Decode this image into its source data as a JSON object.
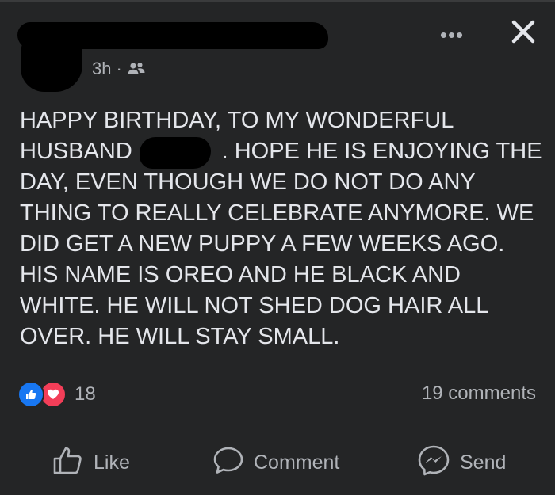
{
  "post": {
    "time": "3h",
    "separator": "·",
    "audience_icon": "friends-icon",
    "text": "HAPPY BIRTHDAY, TO MY WONDERFUL\nHUSBAND              . HOPE HE IS ENJOYING THE\nDAY, EVEN THOUGH WE DO NOT DO ANY\nTHING TO REALLY CELEBRATE ANYMORE. WE\nDID GET A NEW PUPPY A FEW WEEKS AGO.\nHIS NAME IS OREO AND HE BLACK AND\nWHITE. HE WILL NOT SHED DOG HAIR ALL\nOVER. HE WILL STAY SMALL."
  },
  "header": {
    "more_label": "•••"
  },
  "stats": {
    "reaction_count": "18",
    "comments_label": "19 comments"
  },
  "actions": {
    "like_label": "Like",
    "comment_label": "Comment",
    "send_label": "Send"
  },
  "colors": {
    "background": "#242526",
    "text": "#e4e6eb",
    "secondary_text": "#b0b3b8",
    "like_blue": "#1877f2",
    "love_red": "#f33e58"
  }
}
